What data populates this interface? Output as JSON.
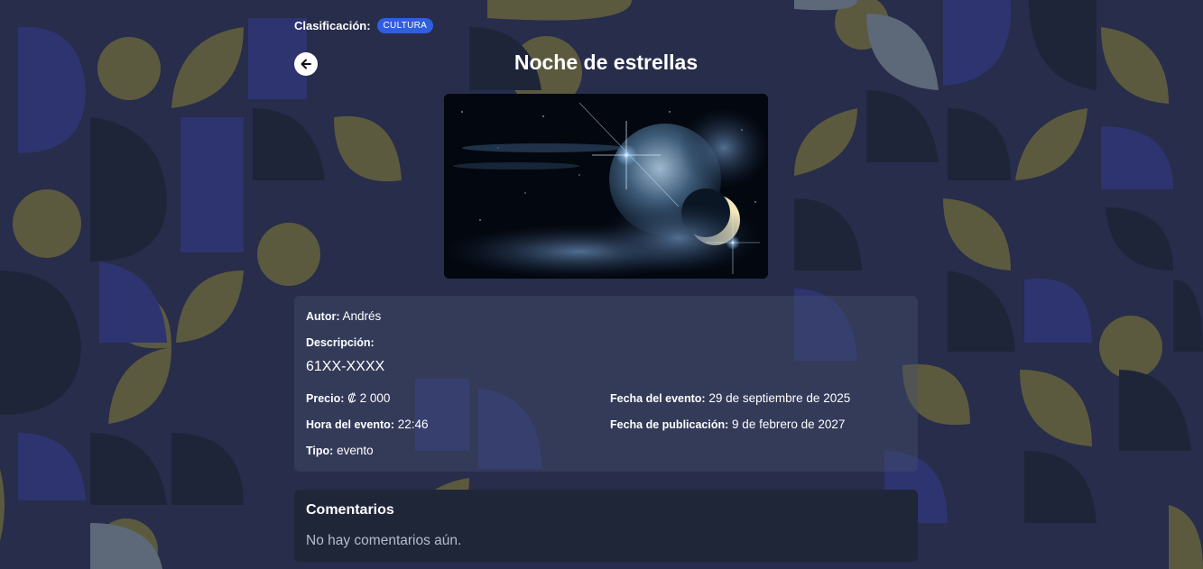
{
  "classification": {
    "label": "Clasificación:",
    "badge": "CULTURA",
    "badge_color": "#2f5fe0"
  },
  "event": {
    "title": "Noche de estrellas",
    "image_icon": "night-sky-planet-moon-image"
  },
  "details": {
    "author_label": "Autor:",
    "author_value": "Andrés",
    "description_label": "Descripción:",
    "description_value": "61XX-XXXX",
    "price_label": "Precio:",
    "price_value": "₡ 2 000",
    "event_date_label": "Fecha del evento:",
    "event_date_value": "29 de septiembre de 2025",
    "event_time_label": "Hora del evento:",
    "event_time_value": "22:46",
    "publication_date_label": "Fecha de publicación:",
    "publication_date_value": "9 de febrero de 2027",
    "type_label": "Tipo:",
    "type_value": "evento"
  },
  "comments": {
    "title": "Comentarios",
    "empty_text": "No hay comentarios aún."
  },
  "colors": {
    "background": "#272d4a",
    "pattern_olive": "#5b5a3f",
    "pattern_blue": "#2e3470",
    "pattern_dark": "#1f2539",
    "pattern_gray": "#5d6878"
  }
}
